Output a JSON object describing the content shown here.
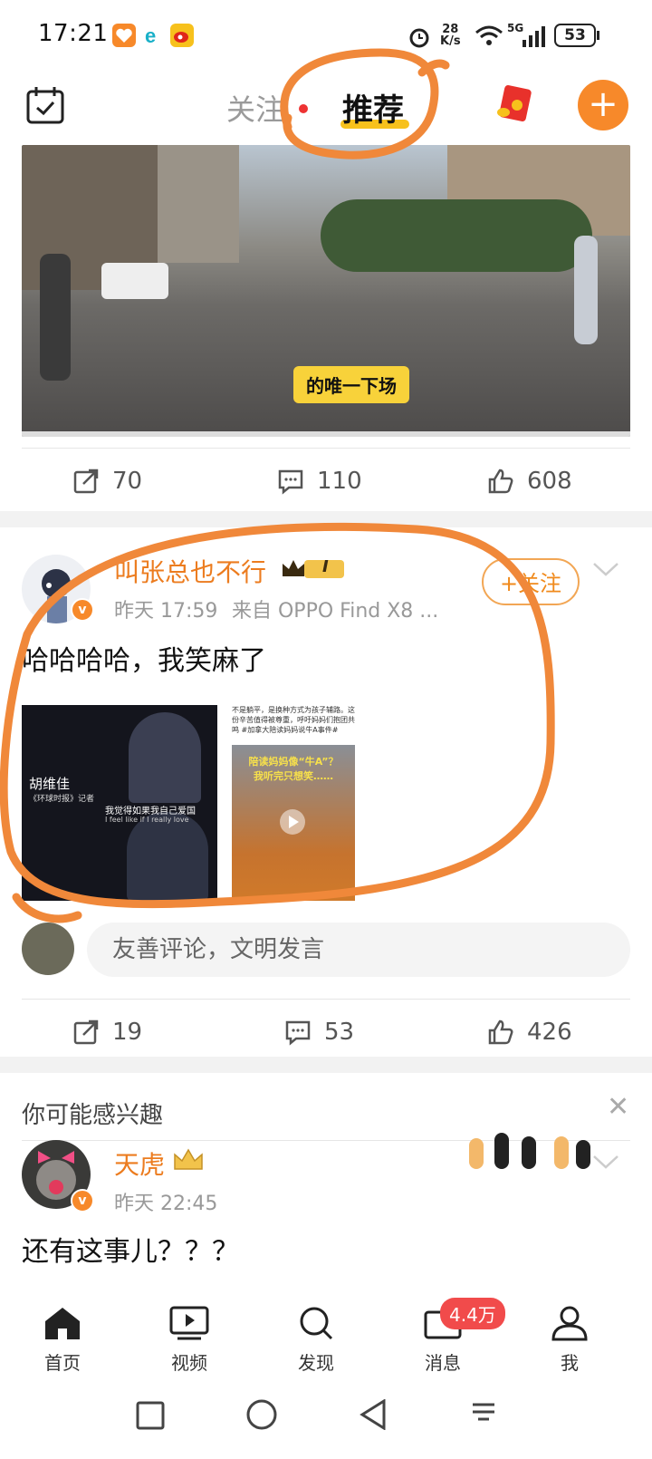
{
  "status_bar": {
    "time": "17:21",
    "net_speed_value": "28",
    "net_speed_unit": "K/s",
    "network": "5G",
    "battery": "53"
  },
  "top_nav": {
    "tab_follow": "关注",
    "tab_recommend": "推荐"
  },
  "video_post": {
    "caption": "的唯一下场",
    "reposts": "70",
    "comments": "110",
    "likes": "608"
  },
  "post": {
    "username": "叫张总也不行",
    "level_badge": "I",
    "time": "昨天 17:59",
    "source": "来自 OPPO Find X8 ...",
    "follow_label": "+关注",
    "text": "哈哈哈哈，我笑麻了",
    "image1_lines": [
      "胡维佳",
      "《环球时报》记者",
      "我觉得如果我自己爱国",
      "I feel like if I really love"
    ],
    "image2_text": "不是躺平，是换种方式为孩子辅路。这份辛苦值得被尊重，呼吁妈妈们抱团共鸣 #加拿大陪读妈妈说牛A事件#",
    "image2_caption": "陪读妈妈像“牛A”？\n我听完只想笑……",
    "comment_placeholder": "友善评论，文明发言",
    "reposts": "19",
    "comments": "53",
    "likes": "426"
  },
  "interest": {
    "title": "你可能感兴趣"
  },
  "post2": {
    "username": "天虎",
    "time": "昨天 22:45",
    "text": "还有这事儿？？？"
  },
  "bottom_nav": {
    "home": "首页",
    "video": "视频",
    "discover": "发现",
    "messages": "消息",
    "messages_badge": "4.4万",
    "me": "我"
  },
  "colors": {
    "brand_orange": "#f7892a",
    "username_orange": "#ec7c1f",
    "highlight_yellow": "#f7c11c",
    "badge_red": "#f14b4b",
    "annotation_orange": "#f0883a"
  }
}
